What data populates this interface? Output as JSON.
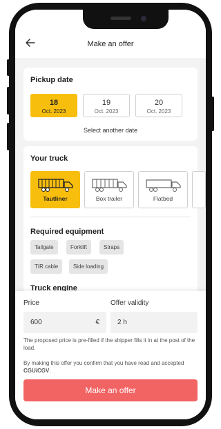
{
  "header": {
    "title": "Make an offer",
    "back_icon": "arrow-left-icon"
  },
  "pickup": {
    "title": "Pickup date",
    "dates": [
      {
        "day": "18",
        "month": "Oct. 2023",
        "selected": true
      },
      {
        "day": "19",
        "month": "Oct. 2023",
        "selected": false
      },
      {
        "day": "20",
        "month": "Oct. 2023",
        "selected": false
      }
    ],
    "another_date": "Select another date"
  },
  "truck": {
    "title": "Your truck",
    "options": [
      {
        "label": "Tautliner",
        "selected": true,
        "icon": "tautliner-truck-icon"
      },
      {
        "label": "Box trailer",
        "selected": false,
        "icon": "box-trailer-truck-icon"
      },
      {
        "label": "Flatbed",
        "selected": false,
        "icon": "flatbed-truck-icon"
      }
    ],
    "equipment_title": "Required equipment",
    "equipment": [
      "Tailgate",
      "Forklift",
      "Straps",
      "TIR cable",
      "Side loading"
    ],
    "engine_title": "Truck engine"
  },
  "offer": {
    "price_label": "Price",
    "price_value": "600",
    "currency": "€",
    "validity_label": "Offer validity",
    "validity_value": "2 h",
    "price_note": "The proposed price is pre-filled if the shipper fills it in at the post of the load.",
    "confirm_prefix": "By making this offer you confirm that you have read and accepted ",
    "confirm_link": "CGU/CGV",
    "confirm_suffix": ".",
    "button": "Make an offer"
  },
  "colors": {
    "accent": "#f8be0e",
    "cta": "#f26464"
  }
}
